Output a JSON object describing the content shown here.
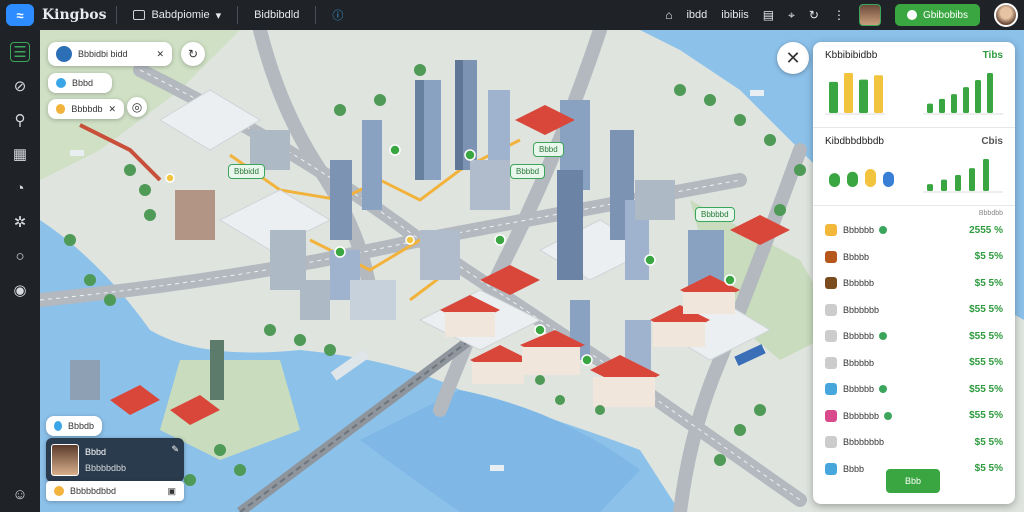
{
  "app": {
    "name": "Kingbos",
    "logo_glyph": "≈"
  },
  "topbar": {
    "menu_label": "Babdpiomie",
    "menu_chevron": "▾",
    "tool_label": "Bidbibdld",
    "right_label_1": "ibdd",
    "right_label_2": "ibibiis",
    "cta_label": "Gbibobibs"
  },
  "map_overlays": {
    "search_pill_label": "Bbbidbi bidd",
    "filter_pill_label": "Bbbd",
    "filter_pill_2_label": "Bbbbdb",
    "label_a": "Bbbidd",
    "label_b": "Bbbd",
    "label_c": "Bbbbbd",
    "label_d": "Bbbbd",
    "mini_pill_label": "Bbbdb",
    "profile_name": "Bbbd",
    "profile_sub": "Bbbbbdbb",
    "profile_status": "Bbbbbdbbd"
  },
  "panel": {
    "section1": {
      "title": "Kbbibibidbb",
      "value": "Tibs"
    },
    "section2": {
      "title": "Kibdbbdbbdb",
      "value": "Cbis"
    },
    "list_header": "Bbbdbb",
    "items": [
      {
        "label": "Bbbbbb",
        "value": "2555 %",
        "color": "#f3b73a",
        "dot": true
      },
      {
        "label": "Bbbbb",
        "value": "$5 5%",
        "color": "#b5561b",
        "dot": false
      },
      {
        "label": "Bbbbbb",
        "value": "$5 5%",
        "color": "#7a4b1f",
        "dot": false
      },
      {
        "label": "Bbbbbbb",
        "value": "$55 5%",
        "color": "#cccccc",
        "dot": false
      },
      {
        "label": "Bbbbbb",
        "value": "$55 5%",
        "color": "#cccccc",
        "dot": true
      },
      {
        "label": "Bbbbbb",
        "value": "$55 5%",
        "color": "#cccccc",
        "dot": false
      },
      {
        "label": "Bbbbbb",
        "value": "$55 5%",
        "color": "#47a7dd",
        "dot": true
      },
      {
        "label": "Bbbbbbb",
        "value": "$55 5%",
        "color": "#d94a8c",
        "dot": true
      },
      {
        "label": "Bbbbbbbb",
        "value": "$5 5%",
        "color": "#cccccc",
        "dot": false
      },
      {
        "label": "Bbbb",
        "value": "$5 5%",
        "color": "#47a7dd",
        "dot": false
      }
    ],
    "button_label": "Bbb"
  },
  "charts": {
    "bars_a": [
      28,
      36,
      30,
      34
    ],
    "bars_b": [
      8,
      12,
      16,
      22,
      28,
      34
    ],
    "bars_c": [
      20,
      22,
      26,
      22
    ],
    "bars_d": [
      6,
      10,
      14,
      20,
      28
    ]
  },
  "colors": {
    "accent": "#3aa641",
    "water": "#7fb7e6",
    "road": "#b9bec4",
    "roof": "#d9473b"
  }
}
